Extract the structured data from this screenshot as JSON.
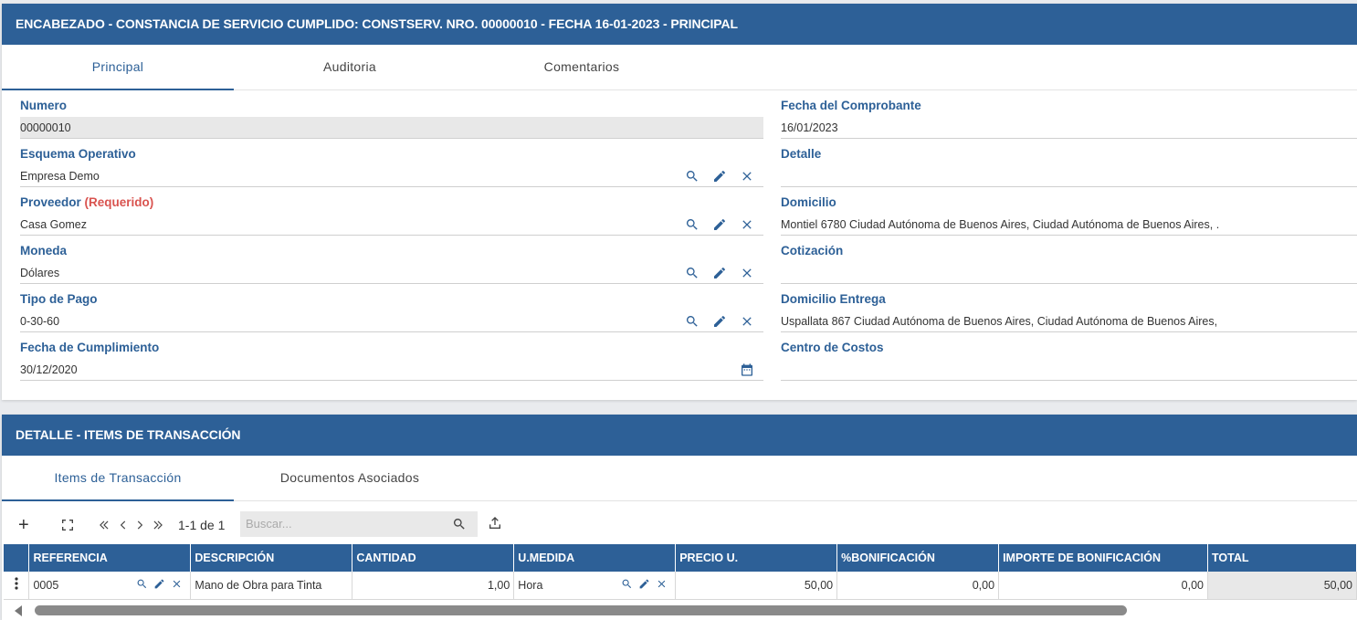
{
  "header_panel": {
    "title": "ENCABEZADO - CONSTANCIA DE SERVICIO CUMPLIDO: CONSTSERV. NRO. 00000010 - FECHA 16-01-2023 - PRINCIPAL",
    "tabs": [
      {
        "label": "Principal",
        "active": true
      },
      {
        "label": "Auditoria",
        "active": false
      },
      {
        "label": "Comentarios",
        "active": false
      }
    ],
    "fields_left": {
      "numero": {
        "label": "Numero",
        "value": "00000010"
      },
      "esquema": {
        "label": "Esquema Operativo",
        "value": "Empresa Demo"
      },
      "proveedor": {
        "label": "Proveedor",
        "required": "(Requerido)",
        "value": "Casa Gomez"
      },
      "moneda": {
        "label": "Moneda",
        "value": "Dólares"
      },
      "tipo_pago": {
        "label": "Tipo de Pago",
        "value": "0-30-60"
      },
      "fecha_cumplimiento": {
        "label": "Fecha de Cumplimiento",
        "value": "30/12/2020"
      }
    },
    "fields_right": {
      "fecha_comprobante": {
        "label": "Fecha del Comprobante",
        "value": "16/01/2023"
      },
      "detalle": {
        "label": "Detalle",
        "value": ""
      },
      "domicilio": {
        "label": "Domicilio",
        "value": "Montiel 6780  Ciudad Autónoma de Buenos Aires, Ciudad Autónoma de Buenos Aires, ."
      },
      "cotizacion": {
        "label": "Cotización",
        "value": ""
      },
      "domicilio_entrega": {
        "label": "Domicilio Entrega",
        "value": "Uspallata 867  Ciudad Autónoma de Buenos Aires, Ciudad Autónoma de Buenos Aires,"
      },
      "centro_costos": {
        "label": "Centro de Costos",
        "value": ""
      }
    }
  },
  "detail_panel": {
    "title": "DETALLE - ITEMS DE TRANSACCIÓN",
    "tabs": [
      {
        "label": "Items de Transacción",
        "active": true
      },
      {
        "label": "Documentos Asociados",
        "active": false
      }
    ],
    "toolbar": {
      "add": "+",
      "pager": "1-1 de 1",
      "search_placeholder": "Buscar..."
    },
    "columns": [
      "REFERENCIA",
      "DESCRIPCIÓN",
      "CANTIDAD",
      "U.MEDIDA",
      "PRECIO U.",
      "%BONIFICACIÓN",
      "IMPORTE DE BONIFICACIÓN",
      "TOTAL"
    ],
    "rows": [
      {
        "referencia": "0005",
        "descripcion": "Mano de Obra para Tinta",
        "cantidad": "1,00",
        "umedida": "Hora",
        "precio": "50,00",
        "bonificacion": "0,00",
        "importe_bonificacion": "0,00",
        "total": "50,00"
      }
    ]
  },
  "colors": {
    "primary": "#2d6097",
    "required": "#d9534f"
  }
}
